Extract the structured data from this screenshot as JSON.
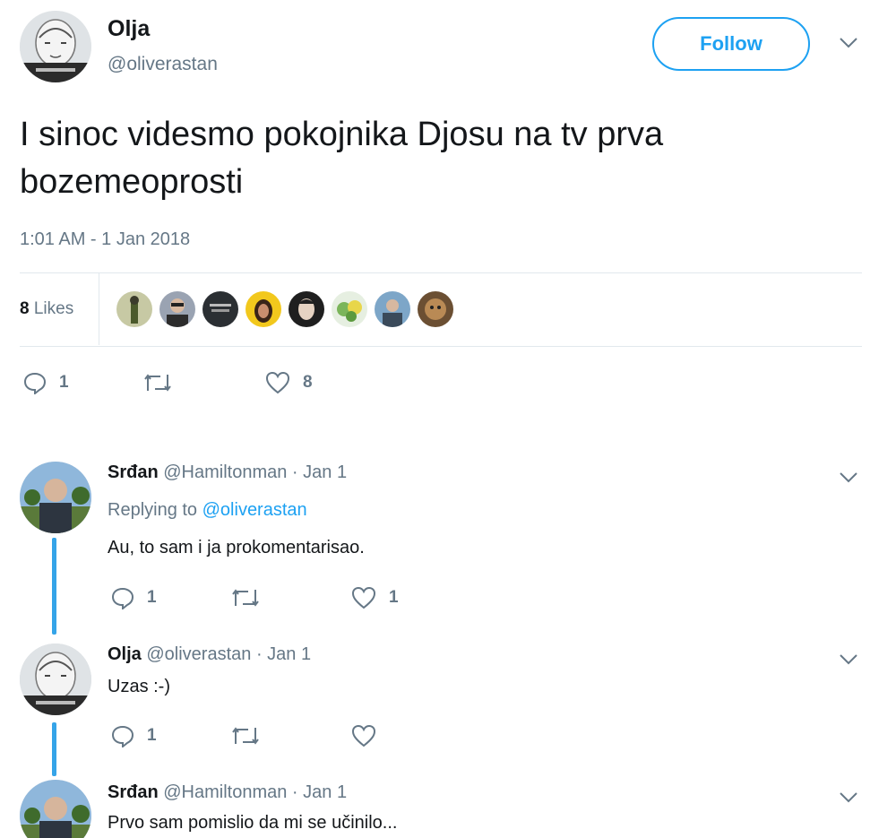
{
  "main_tweet": {
    "name": "Olja",
    "handle": "@oliverastan",
    "follow_label": "Follow",
    "text_line1": "I sinoc videsmo pokojnika Djosu  na tv prva",
    "text_line2": "bozemeoprosti",
    "timestamp": "1:01 AM - 1 Jan 2018",
    "likes_count": "8",
    "likes_label": "Likes",
    "reply_count": "1",
    "retweet_count": "",
    "like_count": "8"
  },
  "replies": [
    {
      "name": "Srđan",
      "meta": "@Hamiltonman · Jan 1",
      "replying_prefix": "Replying to",
      "replying_handle": "@oliverastan",
      "text": "Au, to sam i ja prokomentarisao.",
      "reply_count": "1",
      "like_count": "1"
    },
    {
      "name": "Olja",
      "meta": "@oliverastan · Jan 1",
      "text": "Uzas :-)",
      "reply_count": "1",
      "like_count": ""
    },
    {
      "name": "Srđan",
      "meta": "@Hamiltonman · Jan 1",
      "text": "Prvo sam pomislio da mi se učinilo..."
    }
  ],
  "colors": {
    "accent": "#1da1f2",
    "thread_line": "#35a4e8",
    "secondary_text": "#657786",
    "divider": "#e1e8ed"
  },
  "icons": {
    "reply": "reply-icon",
    "retweet": "retweet-icon",
    "like": "heart-icon",
    "menu": "chevron-down-icon"
  }
}
